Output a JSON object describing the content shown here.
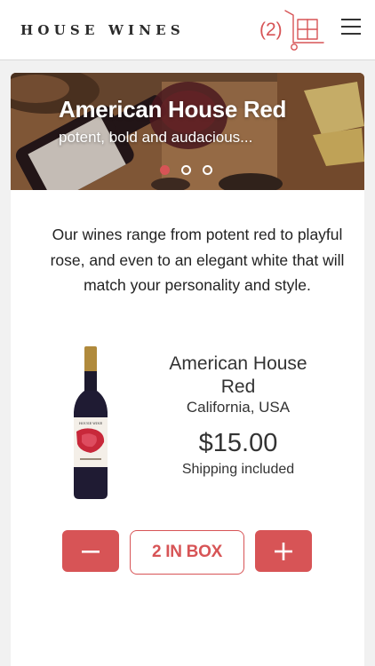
{
  "header": {
    "brand": "HOUSE WINES",
    "cart_count": "(2)",
    "cart_icon": "cart-trolley-icon",
    "menu_icon": "hamburger-menu-icon"
  },
  "banner": {
    "title": "American House Red",
    "subtitle": "potent, bold and audacious...",
    "slides": 3,
    "active_slide": 1
  },
  "main": {
    "intro": "Our wines range from potent red to playful rose, and even to an elegant white that will match your personality and style.",
    "product": {
      "name": "American House Red",
      "origin": "California, USA",
      "price": "$15.00",
      "shipping": "Shipping included",
      "image_icon": "wine-bottle-image"
    },
    "quantity": {
      "label": "2 IN BOX",
      "minus_icon": "minus-icon",
      "plus_icon": "plus-icon"
    }
  },
  "colors": {
    "accent": "#d75456",
    "background": "#f1f1f1",
    "card": "#ffffff"
  }
}
